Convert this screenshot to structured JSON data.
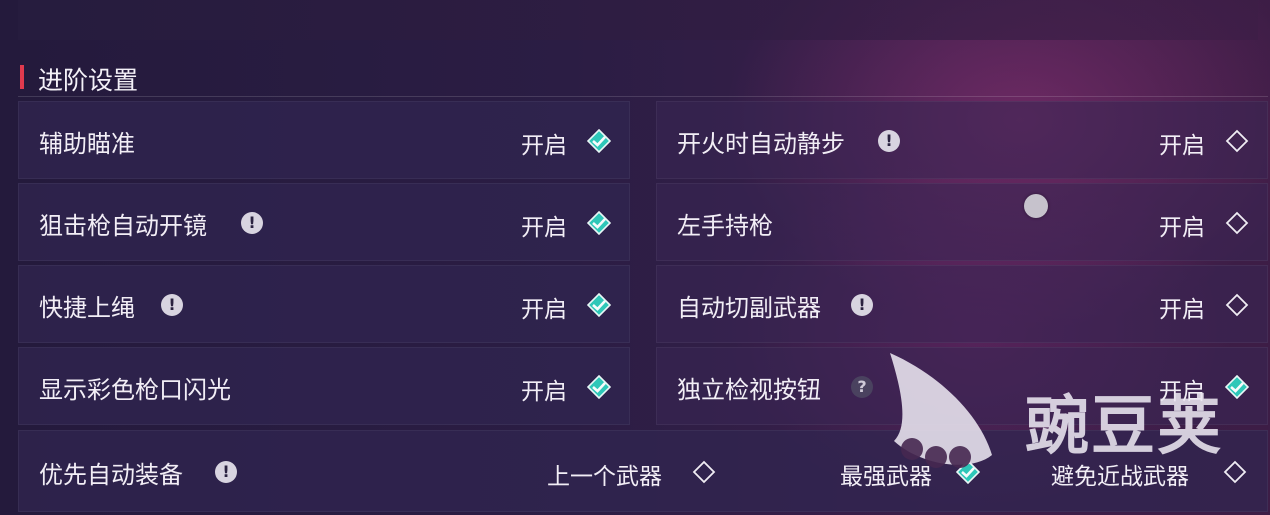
{
  "section": {
    "title": "进阶设置"
  },
  "left_settings": [
    {
      "label": "辅助瞄准",
      "value": "开启",
      "info": false,
      "checked": true
    },
    {
      "label": "狙击枪自动开镜",
      "value": "开启",
      "info": true,
      "checked": true
    },
    {
      "label": "快捷上绳",
      "value": "开启",
      "info": true,
      "checked": true
    },
    {
      "label": "显示彩色枪口闪光",
      "value": "开启",
      "info": false,
      "checked": true
    }
  ],
  "right_settings": [
    {
      "label": "开火时自动静步",
      "value": "开启",
      "info": true,
      "checked": false
    },
    {
      "label": "左手持枪",
      "value": "开启",
      "info": false,
      "checked": false
    },
    {
      "label": "自动切副武器",
      "value": "开启",
      "info": true,
      "checked": false
    },
    {
      "label": "独立检视按钮",
      "value": "开启",
      "info": "question",
      "checked": true
    }
  ],
  "auto_equip": {
    "label": "优先自动装备",
    "options": [
      {
        "label": "上一个武器",
        "checked": false
      },
      {
        "label": "最强武器",
        "checked": true
      },
      {
        "label": "避免近战武器",
        "checked": false
      }
    ]
  },
  "badges": {
    "info": "!",
    "question": "?"
  },
  "watermark": {
    "text": "豌豆荚"
  },
  "colors": {
    "accent": "#e03a4e",
    "check_teal": "#2ec7b8",
    "row_bg": "#302650"
  }
}
